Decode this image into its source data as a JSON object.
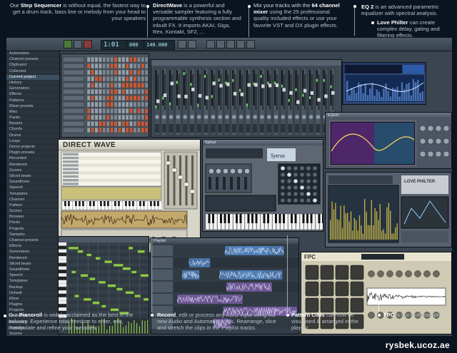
{
  "captions": {
    "step_sequencer": {
      "lead": "Our ",
      "bold": "Step Sequencer",
      "rest": " is without equal, the fastest way to get a drum track, bass line or melody from your head to your speakers"
    },
    "directwave": {
      "bold": "DirectWave",
      "rest": " is a powerful and versatile sampler featuring a fully programmable synthesis section and inbuilt FX. It imports AKAI, Giga, Rex, Kontakt, SF2, ..."
    },
    "mixer": {
      "lead": "Mix your tracks with the ",
      "bold": "64 channel mixer",
      "rest": " using the 25 professional quality included effects or use your favorite VST and DX plugin effects."
    },
    "eq2": {
      "bold": "EQ 2",
      "rest": " is an advanced parametric equalizer with spectral analysis."
    },
    "love_philter": {
      "bold": "Love Philter",
      "rest": " can create complex delay, gating and filtering effects."
    },
    "pianoroll": {
      "lead": "Our ",
      "bold": "Pianoroll",
      "rest": " is widely acclaimed as the best in the industry. Experience total freedom to enter, edit, manipulate and refine your melodies."
    },
    "record": {
      "bold": "Record",
      "rest": ", edit or process any ASIO input using our new Audio and Automation clips. Rearrange, slice and stretch the clips in the Playlist tracks."
    },
    "pattern_clips": {
      "bold": "Pattern Clips",
      "rest": " can now be visualised & arranged in the playlist"
    },
    "fpc": {
      "bold": "FPC",
      "rest": " is our multi sample"
    }
  },
  "watermark": "rysbek.ucoz.ae",
  "daw": {
    "tempo": "1:01",
    "tempo_small": "000",
    "bpm": "140.000",
    "window_titles": {
      "directwave": "DIRECT WAVE",
      "eq": "EQUO",
      "sytrus": "Sytrus",
      "love_philter": "LOVE PHILTER",
      "playlist": "Playlist",
      "fpc": "FPC"
    },
    "browser_items": [
      "Automation",
      "Channel presets",
      "Clipboard",
      "Collected",
      "Current project",
      "History",
      "Generators",
      "Effects",
      "Patterns",
      "Mixer presets",
      "Misc",
      "Packs",
      "Basses",
      "Chords",
      "Drums",
      "Loops",
      "Demo projects",
      "Plugin presets",
      "Recorded",
      "Rendered",
      "Scores",
      "Sliced beats",
      "Soundfonts",
      "Speech",
      "Templates",
      "Channel",
      "Pattern",
      "Scores",
      "Browser",
      "Packs",
      "Projects",
      "Samples",
      "Channel presets",
      "Effects",
      "Generators",
      "Rendered",
      "Sliced beats",
      "Soundfonts",
      "Speech",
      "Templates",
      "Backup",
      "Default",
      "Mixer",
      "Plugins",
      "Projects",
      "Recorded",
      "Rendered",
      "Samples",
      "Scores",
      "Sliced",
      "Speech"
    ]
  },
  "colors": {
    "accent_blue": "#3b78c4",
    "lcd_text": "#b8f0ff",
    "screen_green": "#7ecb43",
    "screen_purple": "#6a3f8a"
  }
}
